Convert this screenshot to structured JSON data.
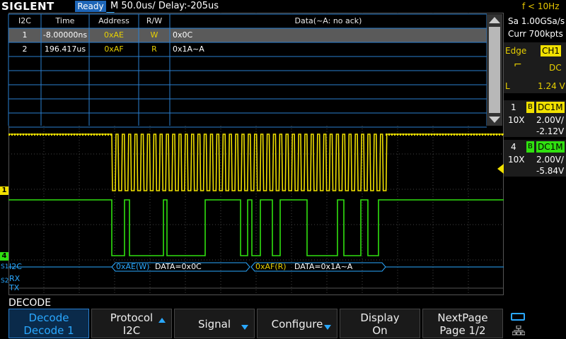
{
  "topbar": {
    "brand": "SIGLENT",
    "status": "Ready",
    "timebase": "M 50.0us/  Delay:-205us",
    "trigger_freq": "f < 10Hz"
  },
  "decode_table": {
    "headers": [
      "I2C",
      "Time",
      "Address",
      "R/W",
      "Data(~A: no ack)"
    ],
    "rows": [
      [
        "1",
        "-8.00000ns",
        "0xAE",
        "W",
        "0x0C"
      ],
      [
        "2",
        "196.417us",
        "0xAF",
        "R",
        "0x1A~A"
      ]
    ]
  },
  "right_panel": {
    "sample_rate": "Sa 1.00GSa/s",
    "memory": "Curr 700kpts",
    "trigger": {
      "type": "Edge",
      "source": "CH1",
      "coupling": "DC",
      "level_label": "L",
      "level": "1.24 V"
    },
    "ch1": {
      "num": "1",
      "bw": "B",
      "coupling": "DC1M",
      "probe": "10X",
      "scale": "2.00V/",
      "offset": "-2.12V"
    },
    "ch4": {
      "num": "4",
      "bw": "B",
      "coupling": "DC1M",
      "probe": "10X",
      "scale": "2.00V/",
      "offset": "-5.84V"
    }
  },
  "markers": {
    "ch1": "1",
    "ch4": "4"
  },
  "bus": {
    "s1_label": "S1",
    "s1_name": "I2C",
    "s2_label": "S2",
    "s2_rx": "RX",
    "s2_tx": "TX",
    "frame1": "0xAE(W)",
    "frame1_data": "DATA=0x0C",
    "frame2": "0xAF(R)",
    "frame2_data": "DATA=0x1A~A"
  },
  "menu": {
    "title": "DECODE",
    "keys": [
      {
        "l1": "Decode",
        "l2": "Decode 1"
      },
      {
        "l1": "Protocol",
        "l2": "I2C"
      },
      {
        "l1": "Signal",
        "l2": ""
      },
      {
        "l1": "Configure",
        "l2": ""
      },
      {
        "l1": "Display",
        "l2": "On"
      },
      {
        "l1": "NextPage",
        "l2": "Page 1/2"
      }
    ]
  },
  "colors": {
    "ch1": "#f0e000",
    "ch4": "#30e010",
    "accent": "#2aa8ff",
    "grid": "#444444"
  }
}
